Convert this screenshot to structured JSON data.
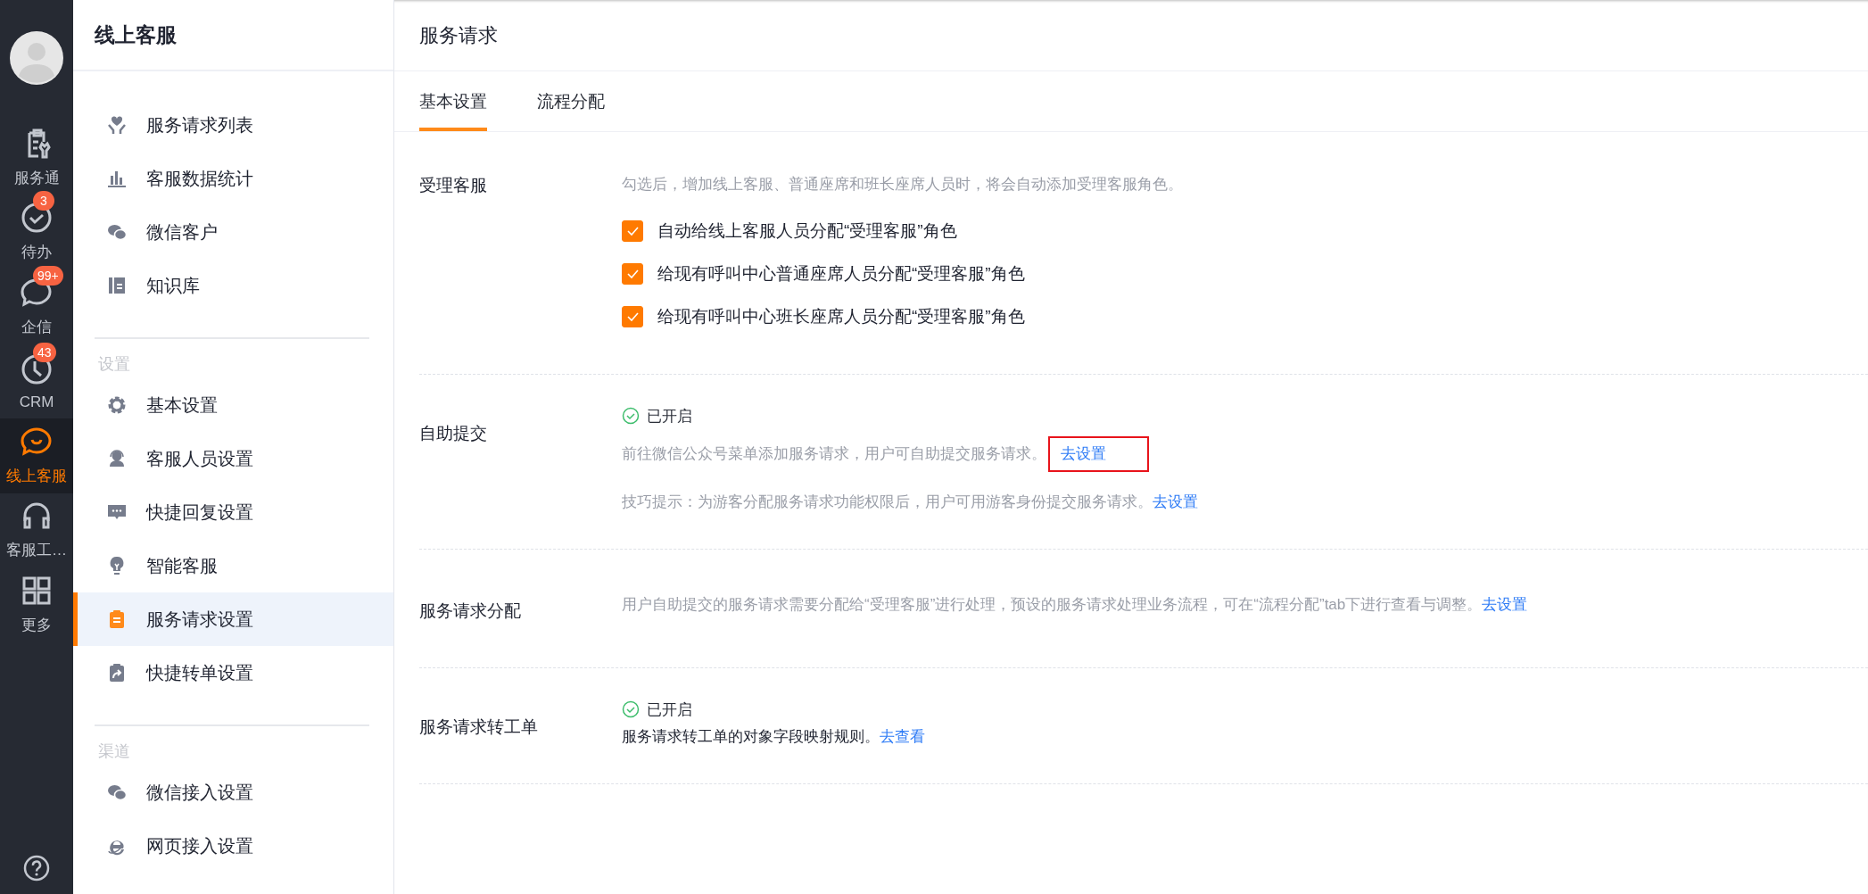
{
  "rail": {
    "items": [
      {
        "label": "服务通",
        "selected": false
      },
      {
        "label": "待办",
        "selected": false,
        "badge": "3"
      },
      {
        "label": "企信",
        "selected": false,
        "badge": "99+"
      },
      {
        "label": "CRM",
        "selected": false,
        "badge": "43"
      },
      {
        "label": "线上客服",
        "selected": true
      },
      {
        "label": "客服工…",
        "selected": false
      },
      {
        "label": "更多",
        "selected": false
      }
    ]
  },
  "sidebar": {
    "title": "线上客服",
    "groups": [
      {
        "items": [
          {
            "label": "服务请求列表",
            "selected": false
          },
          {
            "label": "客服数据统计",
            "selected": false
          },
          {
            "label": "微信客户",
            "selected": false
          },
          {
            "label": "知识库",
            "selected": false
          }
        ]
      },
      {
        "heading": "设置",
        "items": [
          {
            "label": "基本设置",
            "selected": false
          },
          {
            "label": "客服人员设置",
            "selected": false
          },
          {
            "label": "快捷回复设置",
            "selected": false
          },
          {
            "label": "智能客服",
            "selected": false
          },
          {
            "label": "服务请求设置",
            "selected": true
          },
          {
            "label": "快捷转单设置",
            "selected": false
          }
        ]
      },
      {
        "heading": "渠道",
        "items": [
          {
            "label": "微信接入设置",
            "selected": false
          },
          {
            "label": "网页接入设置",
            "selected": false
          }
        ]
      }
    ]
  },
  "main": {
    "title": "服务请求",
    "tabs": [
      {
        "label": "基本设置",
        "selected": true
      },
      {
        "label": "流程分配",
        "selected": false
      }
    ],
    "sections": [
      {
        "kind": "checkboxes",
        "label": "受理客服",
        "description": "勾选后，增加线上客服、普通座席和班长座席人员时，将会自动添加受理客服角色。",
        "options": [
          {
            "label": "自动给线上客服人员分配“受理客服”角色",
            "checked": true
          },
          {
            "label": "给现有呼叫中心普通座席人员分配“受理客服”角色",
            "checked": true
          },
          {
            "label": "给现有呼叫中心班长座席人员分配“受理客服”角色",
            "checked": true
          }
        ]
      },
      {
        "kind": "status",
        "label": "自助提交",
        "status": "已开启",
        "lines": [
          {
            "text": "前往微信公众号菜单添加服务请求，用户可自助提交服务请求。",
            "link": "去设置",
            "muted": true,
            "highlighted": true
          },
          {
            "text": "技巧提示：为游客分配服务请求功能权限后，用户可用游客身份提交服务请求。",
            "link": "去设置",
            "muted": true,
            "highlighted": false
          }
        ]
      },
      {
        "kind": "text",
        "label": "服务请求分配",
        "lines": [
          {
            "text": "用户自助提交的服务请求需要分配给“受理客服”进行处理，预设的服务请求处理业务流程，可在“流程分配”tab下进行查看与调整。",
            "link": "去设置",
            "muted": true,
            "highlighted": false
          }
        ]
      },
      {
        "kind": "status",
        "label": "服务请求转工单",
        "status": "已开启",
        "lines": [
          {
            "text": "服务请求转工单的对象字段映射规则。",
            "link": "去查看",
            "muted": false,
            "highlighted": false
          }
        ]
      }
    ]
  }
}
